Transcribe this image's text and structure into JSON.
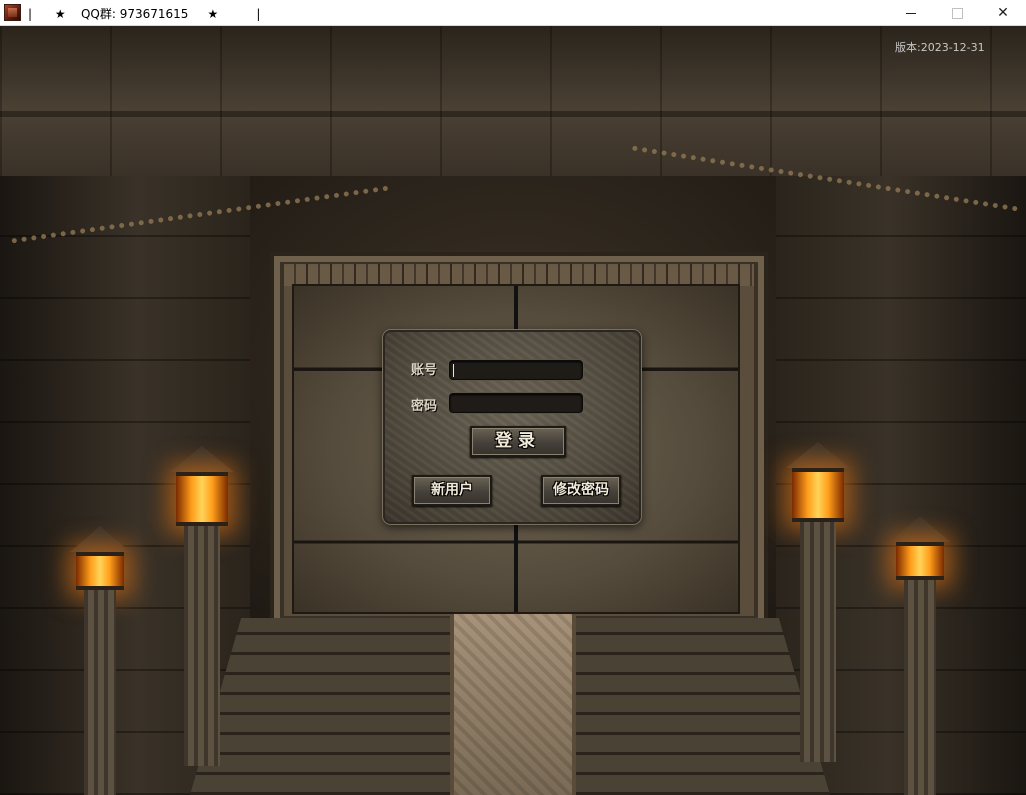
{
  "window": {
    "title": "|      ★    QQ群: 973671615     ★          |",
    "minimize_icon": "minimize-icon",
    "maximize_icon": "maximize-icon",
    "close_glyph": "✕"
  },
  "version": "版本:2023-12-31",
  "login": {
    "account_label": "账号",
    "password_label": "密码",
    "account_value": "",
    "password_value": "",
    "login_button": "登录",
    "new_user_button": "新用户",
    "change_password_button": "修改密码"
  },
  "colors": {
    "panel": "#524b3f",
    "input_bg": "#1f1c18",
    "flame": "#ff9d1a",
    "label": "#dcd4c4"
  }
}
